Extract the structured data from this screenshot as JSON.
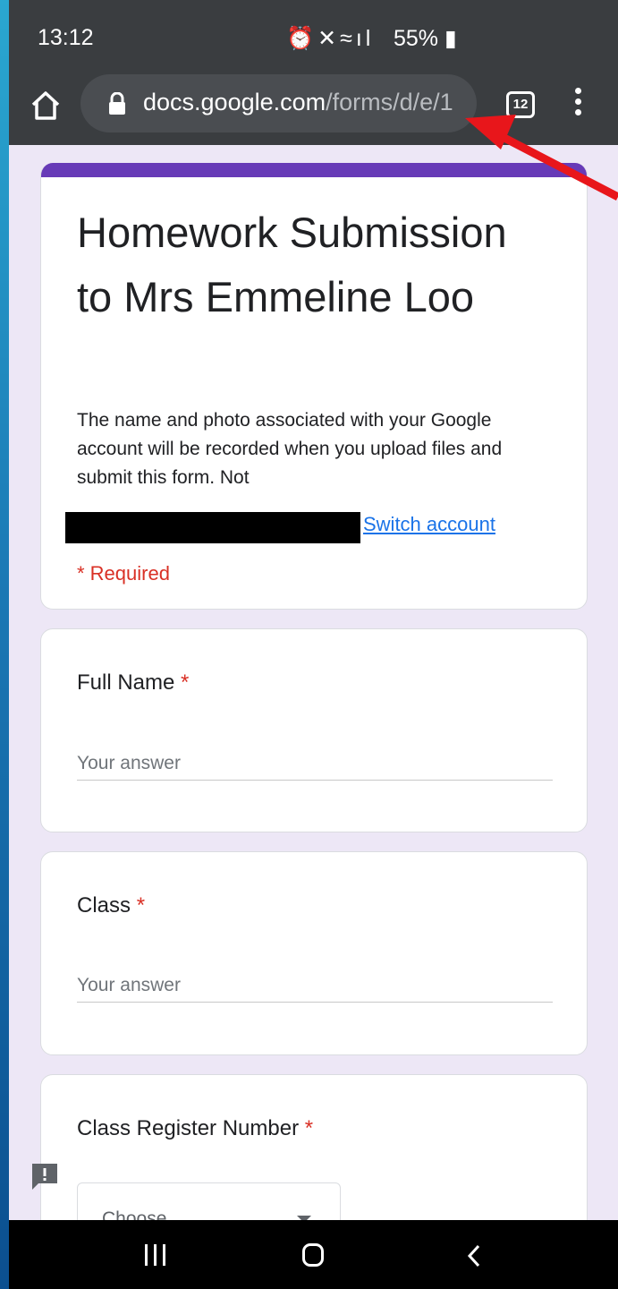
{
  "status_bar": {
    "time": "13:12",
    "icons": [
      "alarm-icon",
      "mute-icon",
      "wifi-icon",
      "signal-icon"
    ],
    "battery": "55%"
  },
  "browser": {
    "url_host": "docs.google.com",
    "url_path": "/forms/d/e/1",
    "tab_count": "12"
  },
  "form": {
    "accent_color": "#673ab7",
    "title": "Homework Submission to Mrs Emmeline Loo",
    "description": "The name and photo associated with your Google account will be recorded when you upload files and submit this form. Not",
    "switch_account": "Switch account",
    "required_note": "* Required",
    "questions": [
      {
        "label": "Full Name",
        "star": "*",
        "placeholder": "Your answer"
      },
      {
        "label": "Class",
        "star": "*",
        "placeholder": "Your answer"
      },
      {
        "label": "Class Register Number",
        "star": "*",
        "select_value": "Choose"
      }
    ]
  },
  "annotation": {
    "color": "#e8161b"
  }
}
